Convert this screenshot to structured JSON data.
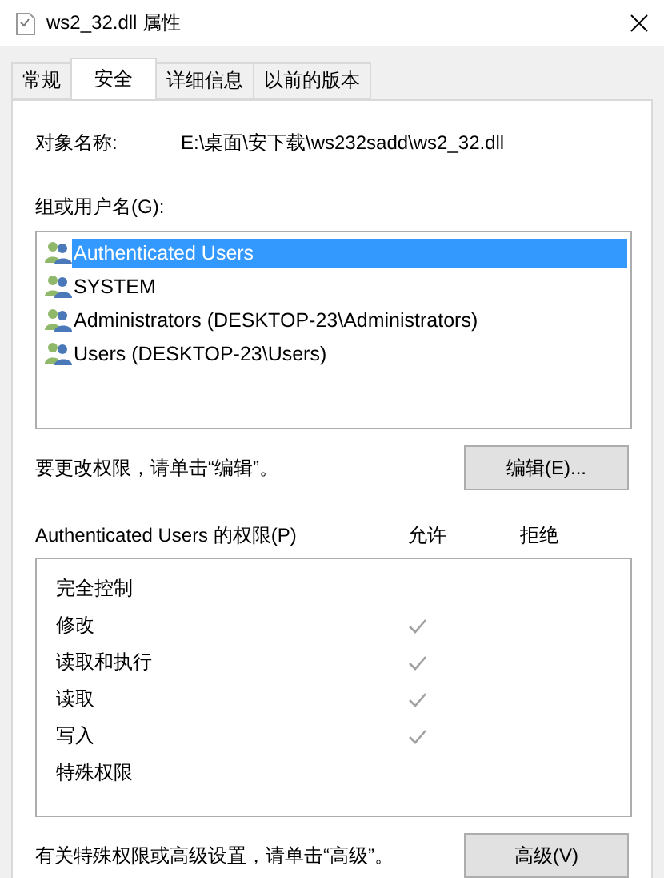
{
  "window": {
    "title": "ws2_32.dll 属性"
  },
  "tabs": [
    {
      "label": "常规",
      "selected": false
    },
    {
      "label": "安全",
      "selected": true
    },
    {
      "label": "详细信息",
      "selected": false
    },
    {
      "label": "以前的版本",
      "selected": false
    }
  ],
  "object_name": {
    "label": "对象名称:",
    "value": "E:\\桌面\\安下载\\ws232sadd\\ws2_32.dll"
  },
  "groups": {
    "label": "组或用户名(G):",
    "items": [
      {
        "name": "Authenticated Users",
        "selected": true
      },
      {
        "name": "SYSTEM",
        "selected": false
      },
      {
        "name": "Administrators (DESKTOP-23\\Administrators)",
        "selected": false
      },
      {
        "name": "Users (DESKTOP-23\\Users)",
        "selected": false
      }
    ]
  },
  "edit_hint": "要更改权限，请单击“编辑”。",
  "edit_button": "编辑(E)...",
  "permissions": {
    "label": "Authenticated Users 的权限(P)",
    "allow_header": "允许",
    "deny_header": "拒绝",
    "items": [
      {
        "name": "完全控制",
        "allow": false,
        "deny": false
      },
      {
        "name": "修改",
        "allow": true,
        "deny": false
      },
      {
        "name": "读取和执行",
        "allow": true,
        "deny": false
      },
      {
        "name": "读取",
        "allow": true,
        "deny": false
      },
      {
        "name": "写入",
        "allow": true,
        "deny": false
      },
      {
        "name": "特殊权限",
        "allow": false,
        "deny": false
      }
    ]
  },
  "advanced_hint": "有关特殊权限或高级设置，请单击“高级”。",
  "advanced_button": "高级(V)"
}
